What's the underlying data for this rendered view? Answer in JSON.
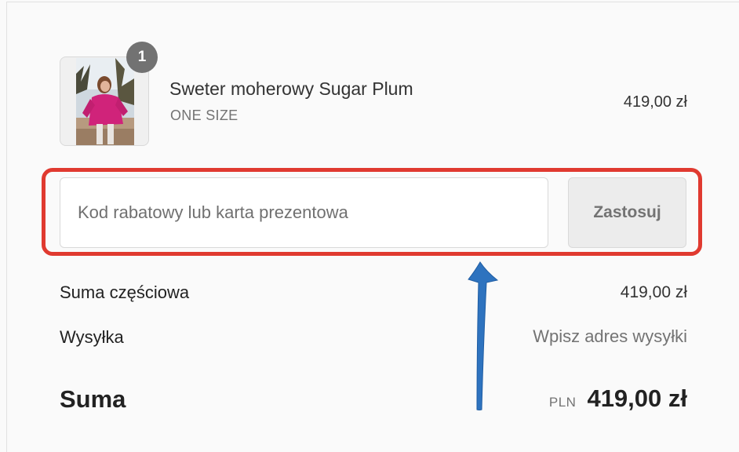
{
  "cart": {
    "quantity_badge": "1",
    "item": {
      "name": "Sweter moherowy Sugar Plum",
      "variant": "ONE SIZE",
      "price": "419,00 zł"
    }
  },
  "discount": {
    "placeholder": "Kod rabatowy lub karta prezentowa",
    "value": "",
    "apply_label": "Zastosuj"
  },
  "summary": {
    "subtotal_label": "Suma częściowa",
    "subtotal_value": "419,00 zł",
    "shipping_label": "Wysyłka",
    "shipping_value": "Wpisz adres wysyłki",
    "total_label": "Suma",
    "currency": "PLN",
    "total_value": "419,00 zł"
  },
  "colors": {
    "highlight": "#e03a30",
    "arrow": "#2e73bf",
    "badge": "#727272"
  }
}
